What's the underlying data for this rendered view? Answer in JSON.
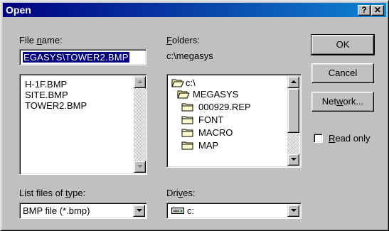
{
  "title": "Open",
  "title_buttons": {
    "help": "?",
    "close": "✕"
  },
  "file_name": {
    "label_pre": "File ",
    "label_accel": "n",
    "label_post": "ame:",
    "value": "EGASYS\\TOWER2.BMP",
    "files": [
      "H-1F.BMP",
      "SITE.BMP",
      "TOWER2.BMP"
    ]
  },
  "folders": {
    "label_accel": "F",
    "label_post": "olders:",
    "current_path": "c:\\megasys",
    "items": [
      {
        "name": "c:\\",
        "icon": "open-folder-icon"
      },
      {
        "name": "MEGASYS",
        "icon": "open-folder-icon"
      },
      {
        "name": "000929.REP",
        "icon": "folder-icon"
      },
      {
        "name": "FONT",
        "icon": "folder-icon"
      },
      {
        "name": "MACRO",
        "icon": "folder-icon"
      },
      {
        "name": "MAP",
        "icon": "folder-icon"
      }
    ]
  },
  "file_type": {
    "label_pre": "List files of ",
    "label_accel": "t",
    "label_post": "ype:",
    "selected": "BMP file (*.bmp)"
  },
  "drives": {
    "label_pre": "Dri",
    "label_accel": "v",
    "label_post": "es:",
    "selected": "c:",
    "icon": "drive-icon"
  },
  "buttons": {
    "ok": "OK",
    "cancel": "Cancel",
    "network_pre": "Net",
    "network_accel": "w",
    "network_post": "ork..."
  },
  "read_only": {
    "label_accel": "R",
    "label_post": "ead only",
    "checked": false
  },
  "colors": {
    "titlebar_start": "#000080",
    "titlebar_end": "#1084d0",
    "dialog_face": "#c0c0c0",
    "selection": "#000080"
  }
}
